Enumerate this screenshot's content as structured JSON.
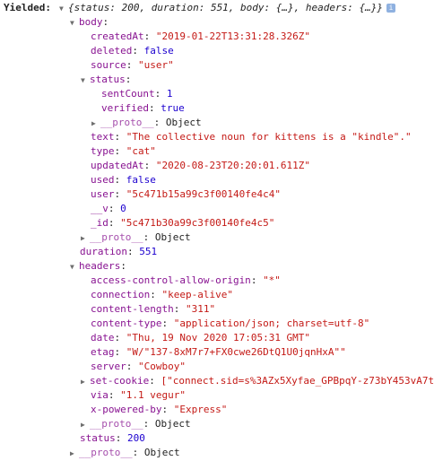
{
  "label": "Yielded:",
  "summary": {
    "text": "{status: 200, duration: 551, body: {…}, headers: {…}}",
    "info_icon": "i"
  },
  "body": {
    "key": "body",
    "createdAt": {
      "key": "createdAt",
      "value": "\"2019-01-22T13:31:28.326Z\""
    },
    "deleted": {
      "key": "deleted",
      "value": "false"
    },
    "source": {
      "key": "source",
      "value": "\"user\""
    },
    "status": {
      "key": "status",
      "sentCount": {
        "key": "sentCount",
        "value": "1"
      },
      "verified": {
        "key": "verified",
        "value": "true"
      },
      "proto": {
        "key": "__proto__",
        "value": "Object"
      }
    },
    "text": {
      "key": "text",
      "value": "\"The collective noun for kittens is a \"kindle\".\""
    },
    "type": {
      "key": "type",
      "value": "\"cat\""
    },
    "updatedAt": {
      "key": "updatedAt",
      "value": "\"2020-08-23T20:20:01.611Z\""
    },
    "used": {
      "key": "used",
      "value": "false"
    },
    "user": {
      "key": "user",
      "value": "\"5c471b15a99c3f00140fe4c4\""
    },
    "v": {
      "key": "__v",
      "value": "0"
    },
    "id": {
      "key": "_id",
      "value": "\"5c471b30a99c3f00140fe4c5\""
    },
    "proto": {
      "key": "__proto__",
      "value": "Object"
    }
  },
  "duration": {
    "key": "duration",
    "value": "551"
  },
  "headers": {
    "key": "headers",
    "acao": {
      "key": "access-control-allow-origin",
      "value": "\"*\""
    },
    "connection": {
      "key": "connection",
      "value": "\"keep-alive\""
    },
    "content_length": {
      "key": "content-length",
      "value": "\"311\""
    },
    "content_type": {
      "key": "content-type",
      "value": "\"application/json; charset=utf-8\""
    },
    "date": {
      "key": "date",
      "value": "\"Thu, 19 Nov 2020 17:05:31 GMT\""
    },
    "etag": {
      "key": "etag",
      "value": "\"W/\"137-8xM7r7+FX0cwe26DtQ1U0jqnHxA\"\""
    },
    "server": {
      "key": "server",
      "value": "\"Cowboy\""
    },
    "set_cookie": {
      "key": "set-cookie",
      "value": "[\"connect.sid=s%3AZx5Xyfae_GPBpqY-z73bY453vA7t"
    },
    "via": {
      "key": "via",
      "value": "\"1.1 vegur\""
    },
    "x_powered_by": {
      "key": "x-powered-by",
      "value": "\"Express\""
    },
    "proto": {
      "key": "__proto__",
      "value": "Object"
    }
  },
  "status": {
    "key": "status",
    "value": "200"
  },
  "proto": {
    "key": "__proto__",
    "value": "Object"
  },
  "icons": {
    "expanded": "triangle-down-icon",
    "collapsed": "triangle-right-icon",
    "info": "info-icon"
  }
}
